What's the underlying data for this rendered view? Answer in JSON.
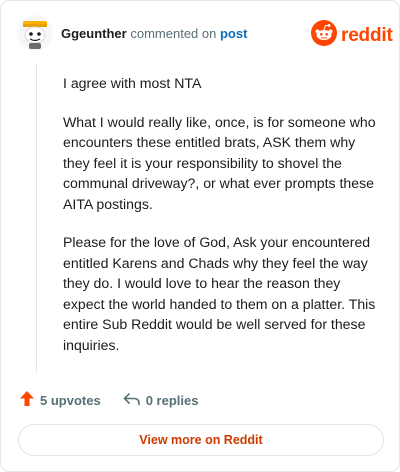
{
  "header": {
    "username": "Ggeunther",
    "commented_text": "commented on",
    "post_link": "post",
    "brand": "reddit"
  },
  "comment": {
    "paragraphs": [
      "I agree with most NTA",
      "What I would really like, once, is for someone who encounters these entitled brats, ASK them why they feel it is your responsibility to shovel the communal driveway?, or what ever prompts these AITA postings.",
      "Please for the love of God, Ask your encountered entitled Karens and Chads why they feel the way they do. I would love to hear the reason they expect the world handed to them on a platter. This entire Sub Reddit would be well served for these inquiries."
    ]
  },
  "actions": {
    "upvotes": "5 upvotes",
    "replies": "0 replies"
  },
  "view_more": "View more on Reddit",
  "colors": {
    "brand": "#ff4500",
    "upvote": "#ff4500",
    "link": "#0a6ebd",
    "view_more_text": "#cc3a00"
  },
  "icons": {
    "avatar": "snoo-avatar-icon",
    "brand": "reddit-logo-icon",
    "upvote": "upvote-arrow-icon",
    "reply": "reply-arrow-icon"
  }
}
